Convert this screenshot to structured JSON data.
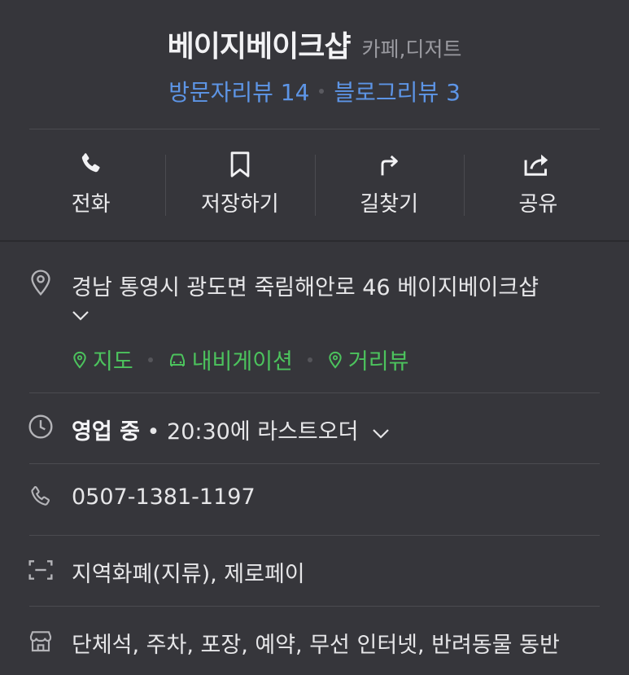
{
  "header": {
    "name": "베이지베이크샵",
    "category": "카페,디저트",
    "visitor_reviews": "방문자리뷰 14",
    "blog_reviews": "블로그리뷰 3"
  },
  "actions": [
    {
      "label": "전화",
      "icon": "phone-icon"
    },
    {
      "label": "저장하기",
      "icon": "bookmark-icon"
    },
    {
      "label": "길찾기",
      "icon": "directions-icon"
    },
    {
      "label": "공유",
      "icon": "share-icon"
    }
  ],
  "address": {
    "text": "경남 통영시 광도면 죽림해안로 46 베이지베이크샵",
    "links": [
      "지도",
      "내비게이션",
      "거리뷰"
    ]
  },
  "hours": {
    "status": "영업 중",
    "detail": "• 20:30에 라스트오더"
  },
  "phone": "0507-1381-1197",
  "payment": "지역화폐(지류), 제로페이",
  "amenities": "단체석, 주차, 포장, 예약, 무선 인터넷, 반려동물 동반",
  "colors": {
    "background": "#36363b",
    "link_blue": "#5d95e6",
    "link_green": "#4cc35d"
  }
}
